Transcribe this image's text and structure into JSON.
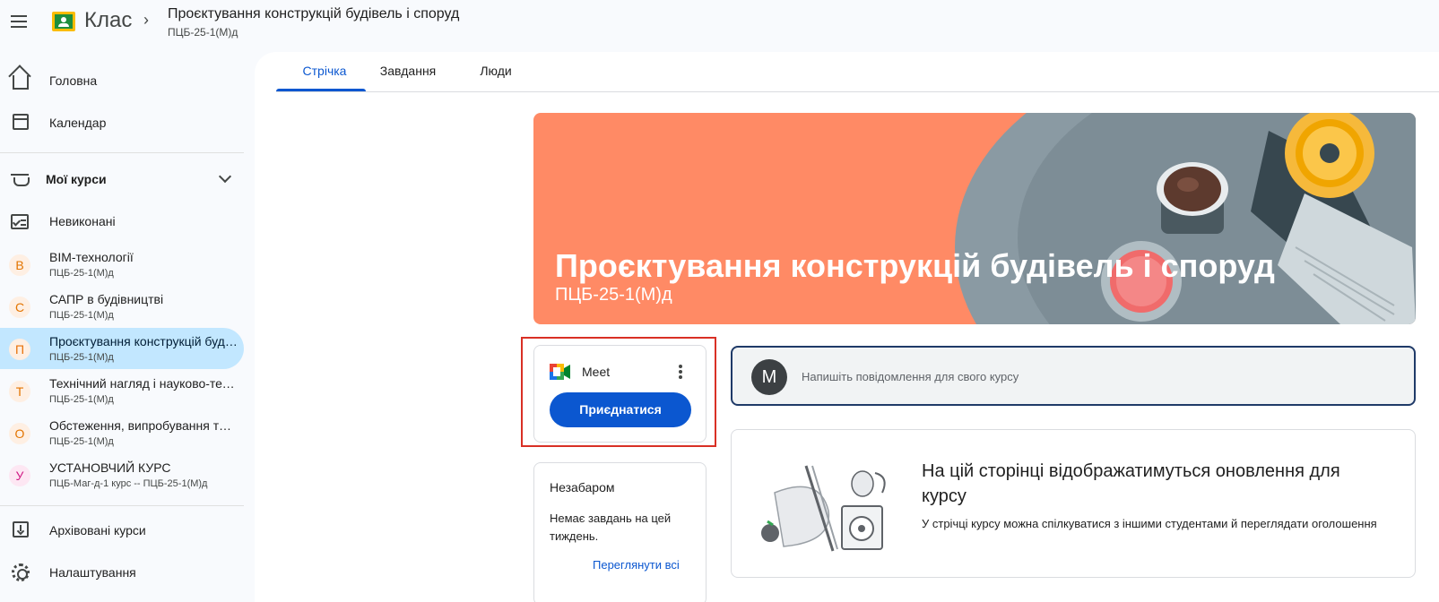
{
  "app": {
    "name": "Клас",
    "breadcrumb_separator": "›",
    "course_title": "Проєктування конструкцій будівель і споруд",
    "course_subtitle": "ПЦБ-25-1(М)д"
  },
  "sidebar": {
    "home": "Головна",
    "calendar": "Календар",
    "my_courses": "Мої курси",
    "todo": "Невиконані",
    "courses": [
      {
        "letter": "B",
        "name": "BIM-технології",
        "section": "ПЦБ-25-1(М)д",
        "color": "#e37400",
        "bg": "#feefe3",
        "active": false
      },
      {
        "letter": "С",
        "name": "САПР в будівництві",
        "section": "ПЦБ-25-1(М)д",
        "color": "#e37400",
        "bg": "#feefe3",
        "active": false
      },
      {
        "letter": "П",
        "name": "Проєктування конструкцій будівель і споруд",
        "section": "ПЦБ-25-1(М)д",
        "color": "#e8710a",
        "bg": "#feefe3",
        "active": true
      },
      {
        "letter": "Т",
        "name": "Технічний нагляд і науково-технічний супровід",
        "section": "ПЦБ-25-1(М)д",
        "color": "#e37400",
        "bg": "#feefe3",
        "active": false
      },
      {
        "letter": "О",
        "name": "Обстеження, випробування та моніторинг",
        "section": "ПЦБ-25-1(М)д",
        "color": "#e37400",
        "bg": "#feefe3",
        "active": false
      },
      {
        "letter": "У",
        "name": "УСТАНОВЧИЙ КУРС",
        "section": "ПЦБ-Маг-д-1 курс -- ПЦБ-25-1(М)д",
        "color": "#d01884",
        "bg": "#fde7f3",
        "active": false
      }
    ],
    "archived": "Архівовані курси",
    "settings": "Налаштування"
  },
  "tabs": [
    "Стрічка",
    "Завдання",
    "Люди"
  ],
  "banner": {
    "title": "Проєктування конструкцій будівель і споруд",
    "subtitle": "ПЦБ-25-1(М)д",
    "color": "#ff8a65"
  },
  "meet": {
    "label": "Meet",
    "join": "Приєднатися"
  },
  "upcoming": {
    "title": "Незабаром",
    "text": "Немає завдань на цей тиждень.",
    "link": "Переглянути всі"
  },
  "composer": {
    "avatar_letter": "M",
    "placeholder": "Напишіть повідомлення для свого курсу"
  },
  "empty_state": {
    "heading": "На цій сторінці відображатимуться оновлення для курсу",
    "body": "У стрічці курсу можна спілкуватися з іншими студентами й переглядати оголошення"
  },
  "colors": {
    "accent": "#0b57d0",
    "active_nav": "#c2e7ff",
    "highlight": "#d93025"
  }
}
